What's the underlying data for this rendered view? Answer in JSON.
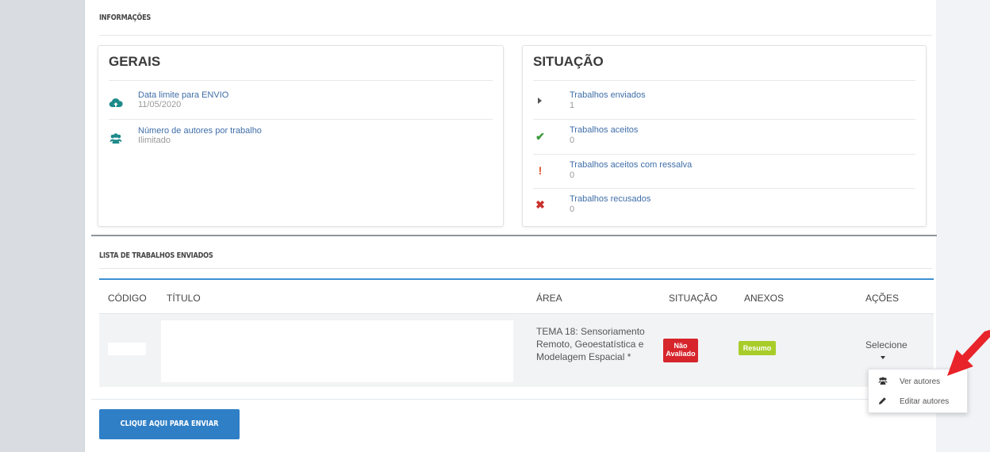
{
  "info_section": {
    "title": "INFORMAÇÕES"
  },
  "gerais": {
    "title": "GERAIS",
    "items": [
      {
        "label": "Data limite para ENVIO",
        "value": "11/05/2020",
        "icon": "cloud-upload-icon"
      },
      {
        "label": "Número de autores por trabalho",
        "value": "Ilimitado",
        "icon": "users-icon"
      }
    ]
  },
  "situacao": {
    "title": "SITUAÇÃO",
    "items": [
      {
        "label": "Trabalhos enviados",
        "value": "1",
        "icon": "caret-right-icon",
        "color": "#555555"
      },
      {
        "label": "Trabalhos aceitos",
        "value": "0",
        "icon": "check-icon",
        "color": "#3a9a3a"
      },
      {
        "label": "Trabalhos aceitos com ressalva",
        "value": "0",
        "icon": "exclamation-icon",
        "color": "#e0552a"
      },
      {
        "label": "Trabalhos recusados",
        "value": "0",
        "icon": "times-icon",
        "color": "#c9302c"
      }
    ]
  },
  "list_section": {
    "title": "LISTA DE TRABALHOS ENVIADOS"
  },
  "table": {
    "headers": [
      "CÓDIGO",
      "TÍTULO",
      "ÁREA",
      "SITUAÇÃO",
      "ANEXOS",
      "AÇÕES"
    ],
    "rows": [
      {
        "codigo": "",
        "titulo": "",
        "area": "TEMA 18: Sensoriamento Remoto, Geoestatística e Modelagem Espacial *",
        "situacao": "Não Avaliado",
        "anexos": "Resumo",
        "acoes": "Selecione"
      }
    ]
  },
  "actions_menu": {
    "items": [
      {
        "label": "Ver autores",
        "icon": "users-icon"
      },
      {
        "label": "Editar autores",
        "icon": "pencil-icon"
      }
    ]
  },
  "send_button": {
    "label": "CLIQUE AQUI PARA ENVIAR"
  },
  "colors": {
    "accent": "#2f7fc6",
    "link": "#3f6ea8",
    "badge_danger": "#d7252c",
    "badge_success": "#a8cd2a",
    "arrow": "#e8232a"
  }
}
